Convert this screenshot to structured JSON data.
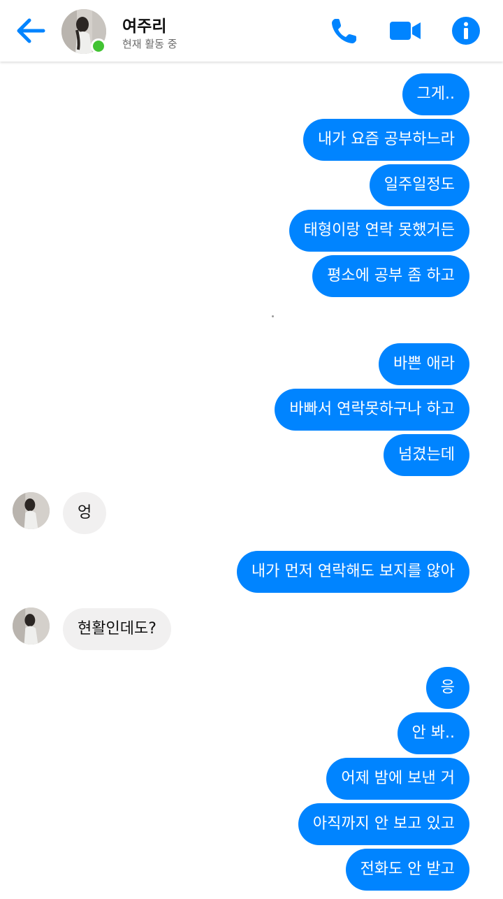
{
  "header": {
    "name": "여주리",
    "status": "현재 활동 중"
  },
  "colors": {
    "accent": "#0084ff",
    "online": "#42c333",
    "received_bubble": "#f1f0f0"
  },
  "icons": {
    "back": "arrow-left-icon",
    "call": "phone-icon",
    "video": "video-camera-icon",
    "info": "info-icon"
  },
  "messages": [
    {
      "from": "me",
      "text": "그게.."
    },
    {
      "from": "me",
      "text": "내가 요즘 공부하느라"
    },
    {
      "from": "me",
      "text": "일주일정도"
    },
    {
      "from": "me",
      "text": "태형이랑 연락 못했거든"
    },
    {
      "from": "me",
      "text": "평소에 공부 좀 하고"
    },
    {
      "from": "me",
      "text": "바쁜 애라"
    },
    {
      "from": "me",
      "text": "바빠서 연락못하구나 하고"
    },
    {
      "from": "me",
      "text": "넘겼는데"
    },
    {
      "from": "them",
      "text": "엉"
    },
    {
      "from": "me",
      "text": "내가 먼저 연락해도 보지를 않아"
    },
    {
      "from": "them",
      "text": "현활인데도?"
    },
    {
      "from": "me",
      "text": "응"
    },
    {
      "from": "me",
      "text": "안 봐.."
    },
    {
      "from": "me",
      "text": "어제 밤에 보낸 거"
    },
    {
      "from": "me",
      "text": "아직까지 안 보고 있고"
    },
    {
      "from": "me",
      "text": "전화도 안 받고"
    }
  ]
}
